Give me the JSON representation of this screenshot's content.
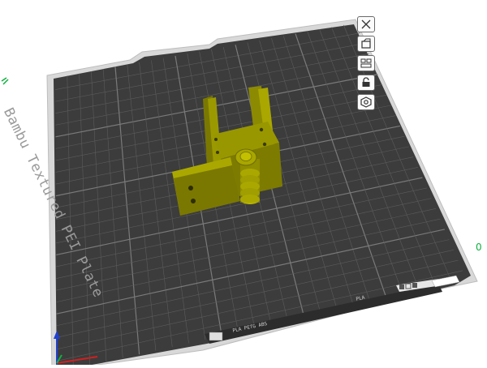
{
  "plate": {
    "name": "Bambu Textured PEI Plate",
    "filament_info": "PLA PETG ABS",
    "secondary_info": "PLA"
  },
  "toolbar": {
    "items": [
      {
        "name": "close-plate-button",
        "icon": "close-icon"
      },
      {
        "name": "orient-button",
        "icon": "orient-icon"
      },
      {
        "name": "arrange-button",
        "icon": "arrange-icon"
      },
      {
        "name": "lock-button",
        "icon": "lock-icon"
      },
      {
        "name": "settings-button",
        "icon": "gear-icon"
      }
    ]
  },
  "axes": {
    "right_label": "0"
  },
  "colors": {
    "plate": "#3c3c3c",
    "grid": "#5c5c5c",
    "rim": "#d8d8d8",
    "model": "#8c8a00",
    "axis_x": "#d02020",
    "axis_y": "#10b040",
    "axis_z": "#2040d0"
  }
}
